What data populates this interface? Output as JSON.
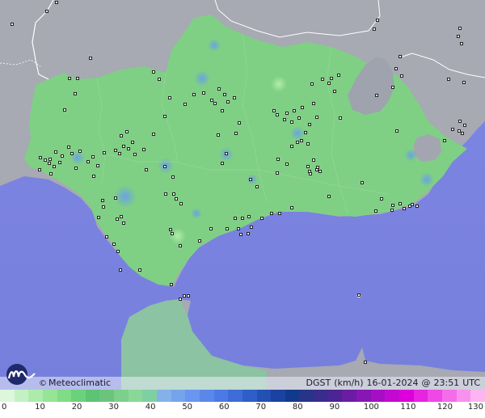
{
  "brand": {
    "copyright": "©",
    "name": "Meteoclimatic"
  },
  "title": {
    "variable": "DGST",
    "unit": "(km/h)",
    "date": "16-01-2024",
    "at": "@",
    "time": "23:51",
    "zone": "UTC"
  },
  "legend": {
    "ticks": [
      "0",
      "10",
      "20",
      "30",
      "40",
      "50",
      "60",
      "70",
      "80",
      "90",
      "100",
      "110",
      "120",
      "130"
    ],
    "colors": [
      "#dcf7dc",
      "#c4f1c4",
      "#acebac",
      "#96e496",
      "#80dc86",
      "#6cd17c",
      "#5cc474",
      "#6cc47c",
      "#7cd08c",
      "#8ad898",
      "#7ed0a0",
      "#86b0e8",
      "#76a4ec",
      "#6896f0",
      "#5a88ea",
      "#4c7ae4",
      "#3e6cd8",
      "#305ec8",
      "#2450b4",
      "#1a42a0",
      "#123a8c",
      "#283488",
      "#3a2c8c",
      "#4c2494",
      "#6a1ca4",
      "#8816b4",
      "#a60ec4",
      "#c408d4",
      "#dc00dc",
      "#e624e2",
      "#ee48e6",
      "#f46cea",
      "#f890ee",
      "#fcb4f2"
    ]
  },
  "map_colors": {
    "sea": "#7b83e0",
    "foreign_land": "#a8aab4",
    "land_low": "#7fd084",
    "land_high": "#9aa0ac",
    "gust_medium": "#7ab0d8",
    "station": "#111111",
    "border": "#ffffff"
  }
}
